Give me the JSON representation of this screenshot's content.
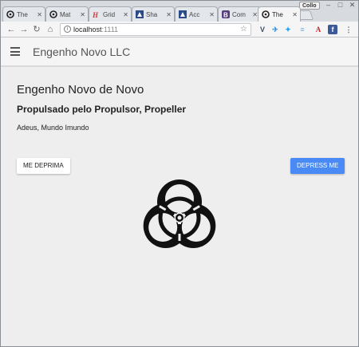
{
  "browser": {
    "tabs": [
      {
        "label": "The",
        "icon": "biohazard-icon",
        "active": false
      },
      {
        "label": "Mat",
        "icon": "biohazard-icon",
        "active": false
      },
      {
        "label": "Grid",
        "icon": "grid-logo-icon",
        "active": false
      },
      {
        "label": "Sha",
        "icon": "shape-logo-icon",
        "active": false
      },
      {
        "label": "Acc",
        "icon": "access-logo-icon",
        "active": false
      },
      {
        "label": "Com",
        "icon": "bootstrap-logo-icon",
        "active": false
      },
      {
        "label": "The",
        "icon": "biohazard-icon",
        "active": true
      }
    ],
    "tab_close": "✕",
    "profile_label": "Collo",
    "url_host": "localhost",
    "url_port": ":1111",
    "extensions": [
      "vue-icon",
      "bird-icon",
      "twitter-icon",
      "menu-lines-icon",
      "acrobat-icon",
      "facebook-icon"
    ]
  },
  "app": {
    "title": "Engenho Novo LLC"
  },
  "content": {
    "heading": "Engenho Novo de Novo",
    "subheading": "Propulsado pelo Propulsor, Propeller",
    "body": "Adeus, Mundo Imundo",
    "button_light": "ME DEPRIMA",
    "button_primary": "DEPRESS ME"
  },
  "colors": {
    "primary_button": "#4a8af4",
    "background": "#eeeeee"
  }
}
